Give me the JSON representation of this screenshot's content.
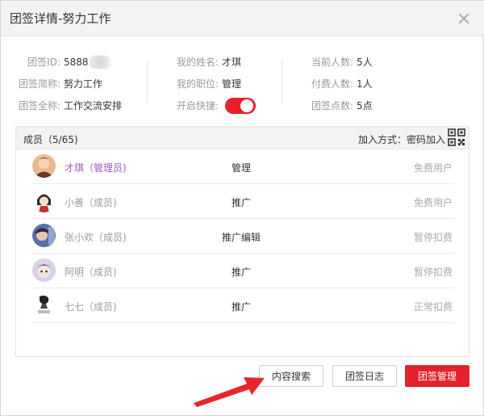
{
  "dialog": {
    "title": "团签详情-努力工作"
  },
  "info": {
    "col1": [
      {
        "label": "团签ID:",
        "value": "5888"
      },
      {
        "label": "团签简称:",
        "value": "努力工作"
      },
      {
        "label": "团签全称:",
        "value": "工作交流安排"
      }
    ],
    "col2": [
      {
        "label": "我的姓名:",
        "value": "才琪"
      },
      {
        "label": "我的职位:",
        "value": "管理"
      },
      {
        "label": "开启快捷:",
        "toggle_on": true
      }
    ],
    "col3": [
      {
        "label": "当前人数:",
        "value": "5人"
      },
      {
        "label": "付费人数:",
        "value": "1人"
      },
      {
        "label": "团签点数:",
        "value": "5点"
      }
    ]
  },
  "members": {
    "title": "成员（5/65)",
    "join_method": "加入方式：密码加入",
    "rows": [
      {
        "name": "才琪（管理员)",
        "role": "管理",
        "status": "免费用户",
        "avatar": "avatar-1",
        "admin": true
      },
      {
        "name": "小善（成员)",
        "role": "推广",
        "status": "免费用户",
        "avatar": "avatar-2"
      },
      {
        "name": "张小欢（成员)",
        "role": "推广编辑",
        "status": "暂停扣费",
        "avatar": "avatar-3"
      },
      {
        "name": "阿明（成员)",
        "role": "推广",
        "status": "暂停扣费",
        "avatar": "avatar-4"
      },
      {
        "name": "七七（成员)",
        "role": "推广",
        "status": "正常扣费",
        "avatar": "avatar-5"
      }
    ]
  },
  "buttons": {
    "search": "内容搜索",
    "log": "团签日志",
    "manage": "团签管理"
  },
  "colors": {
    "accent": "#e3222d",
    "admin_name": "#9b59c6",
    "arrow": "#e8262c"
  }
}
